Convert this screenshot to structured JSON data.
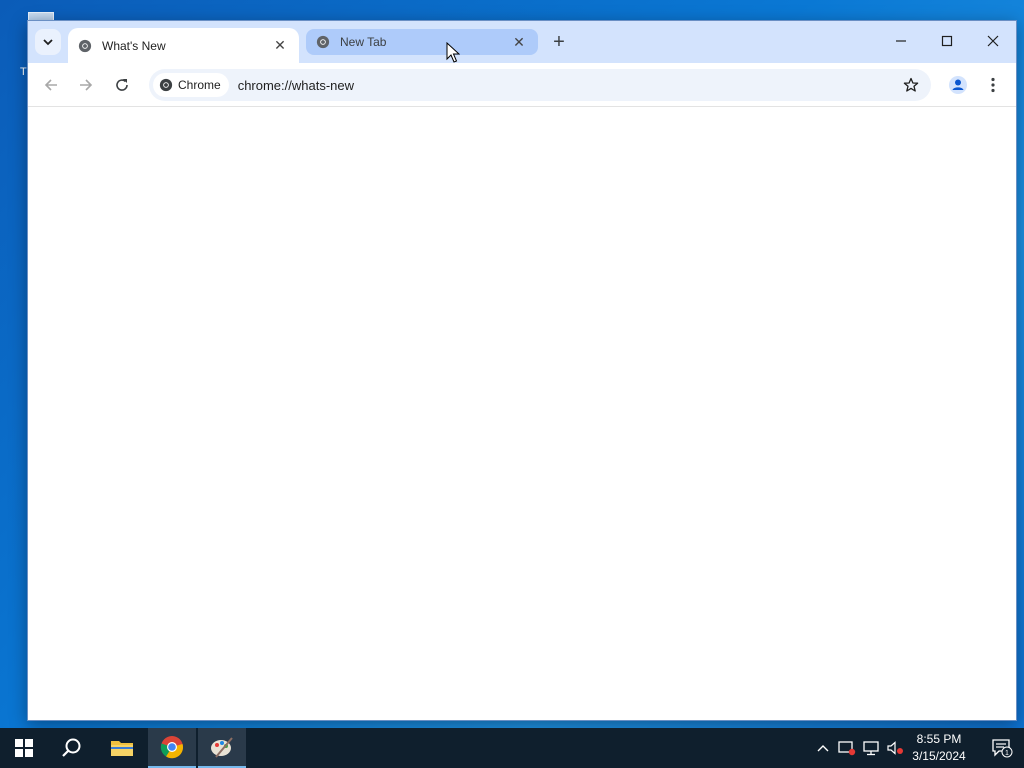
{
  "desktop": {
    "icon_label": "Tl"
  },
  "browser": {
    "tabs": [
      {
        "title": "What's New",
        "active": true
      },
      {
        "title": "New Tab",
        "active": false
      }
    ],
    "new_tab_symbol": "+",
    "close_symbol": "✕",
    "omnibox": {
      "chip_label": "Chrome",
      "url": "chrome://whats-new"
    }
  },
  "icons": {
    "tab_search": "chevron-down-icon",
    "back": "back-arrow-icon",
    "forward": "forward-arrow-icon",
    "reload": "reload-icon",
    "bookmark": "star-icon",
    "profile": "profile-icon",
    "menu": "kebab-menu-icon"
  },
  "taskbar": {
    "time": "8:55 PM",
    "date": "3/15/2024",
    "notification_count": "1"
  },
  "colors": {
    "tabstrip": "#d3e3fd",
    "inactive_tab": "#aecbfa",
    "omnibox": "#eef3fb",
    "taskbar": "#0f1f2d"
  }
}
